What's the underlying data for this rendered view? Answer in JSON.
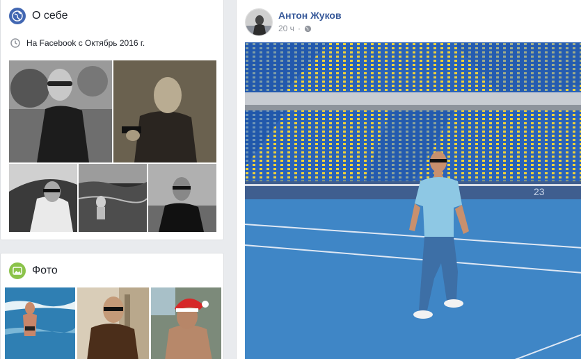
{
  "about": {
    "title": "О себе",
    "since": "На Facebook с Октябрь 2016 г.",
    "icons": {
      "header": "globe-icon",
      "since": "clock-icon"
    }
  },
  "photos_section": {
    "title": "Фото",
    "icon": "photo-icon"
  },
  "post": {
    "author": "Антон Жуков",
    "time": "20 ч",
    "separator": "·",
    "audience_icon": "public-globe-icon",
    "jersey_number": "23"
  },
  "colors": {
    "link": "#365899",
    "meta": "#90949c",
    "globe": "#4267b2",
    "photo_icon": "#8bc34a",
    "page_bg": "#e9ebee"
  }
}
